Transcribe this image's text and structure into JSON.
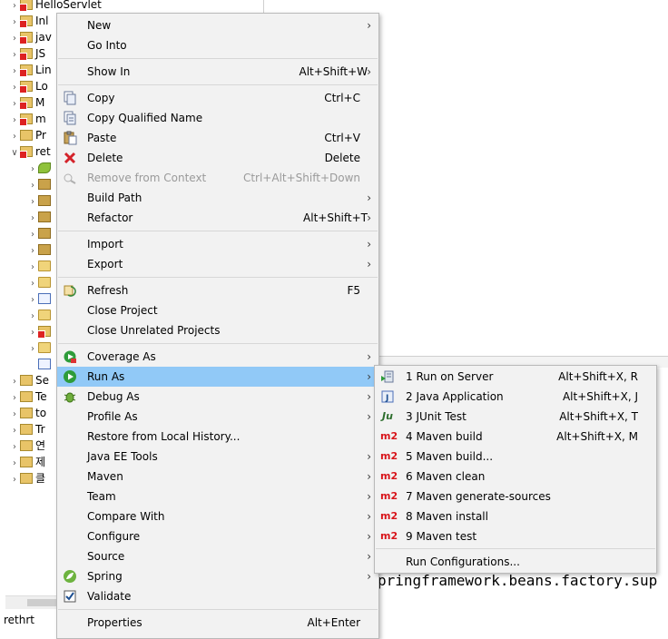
{
  "explorer": {
    "rows": [
      {
        "text": "HelloServlet",
        "icon": "project-error-icon"
      },
      {
        "text": "Inl",
        "icon": "project-error-icon"
      },
      {
        "text": "jav",
        "icon": "project-error-icon"
      },
      {
        "text": "JS",
        "icon": "project-error-icon"
      },
      {
        "text": "Lin",
        "icon": "project-error-icon"
      },
      {
        "text": "Lo",
        "icon": "project-error-icon"
      },
      {
        "text": "M",
        "icon": "project-error-icon"
      },
      {
        "text": "m",
        "icon": "project-error-icon"
      },
      {
        "text": "Pr",
        "icon": "project-icon"
      },
      {
        "text": "ret",
        "icon": "maven-project-error-icon"
      },
      {
        "text": "Se",
        "icon": "project-icon"
      },
      {
        "text": "Te",
        "icon": "project-icon"
      },
      {
        "text": "to",
        "icon": "project-icon"
      },
      {
        "text": "Tr",
        "icon": "project-icon"
      },
      {
        "text": "연",
        "icon": "project-icon"
      },
      {
        "text": "제",
        "icon": "project-icon"
      },
      {
        "text": "클",
        "icon": "project-icon"
      }
    ],
    "status_text": "rethrt"
  },
  "editor": {
    "fragments": [
      "pringframework.beans.factory.sup"
    ]
  },
  "context_menu": {
    "items": [
      {
        "label": "New",
        "submenu": true
      },
      {
        "label": "Go Into"
      },
      {
        "sep": true
      },
      {
        "label": "Show In",
        "accel": "Alt+Shift+W",
        "submenu": true
      },
      {
        "sep": true
      },
      {
        "label": "Copy",
        "accel": "Ctrl+C",
        "icon": "copy-icon"
      },
      {
        "label": "Copy Qualified Name",
        "icon": "copy-qualified-icon"
      },
      {
        "label": "Paste",
        "accel": "Ctrl+V",
        "icon": "paste-icon"
      },
      {
        "label": "Delete",
        "accel": "Delete",
        "icon": "delete-icon"
      },
      {
        "label": "Remove from Context",
        "accel": "Ctrl+Alt+Shift+Down",
        "icon": "remove-context-icon",
        "disabled": true
      },
      {
        "label": "Build Path",
        "submenu": true
      },
      {
        "label": "Refactor",
        "accel": "Alt+Shift+T",
        "submenu": true
      },
      {
        "sep": true
      },
      {
        "label": "Import",
        "submenu": true
      },
      {
        "label": "Export",
        "submenu": true
      },
      {
        "sep": true
      },
      {
        "label": "Refresh",
        "accel": "F5",
        "icon": "refresh-icon"
      },
      {
        "label": "Close Project"
      },
      {
        "label": "Close Unrelated Projects"
      },
      {
        "sep": true
      },
      {
        "label": "Coverage As",
        "submenu": true,
        "icon": "coverage-icon"
      },
      {
        "label": "Run As",
        "submenu": true,
        "icon": "run-icon",
        "highlighted": true
      },
      {
        "label": "Debug As",
        "submenu": true,
        "icon": "debug-icon"
      },
      {
        "label": "Profile As",
        "submenu": true
      },
      {
        "label": "Restore from Local History..."
      },
      {
        "label": "Java EE Tools",
        "submenu": true
      },
      {
        "label": "Maven",
        "submenu": true
      },
      {
        "label": "Team",
        "submenu": true
      },
      {
        "label": "Compare With",
        "submenu": true
      },
      {
        "label": "Configure",
        "submenu": true
      },
      {
        "label": "Source",
        "submenu": true
      },
      {
        "label": "Spring",
        "submenu": true,
        "icon": "spring-icon"
      },
      {
        "label": "Validate",
        "icon": "validate-check-icon"
      },
      {
        "sep": true
      },
      {
        "label": "Properties",
        "accel": "Alt+Enter"
      }
    ]
  },
  "run_as_submenu": {
    "items": [
      {
        "label": "1 Run on Server",
        "accel": "Alt+Shift+X, R",
        "icon": "server-run-icon",
        "glyph": ""
      },
      {
        "label": "2 Java Application",
        "accel": "Alt+Shift+X, J",
        "icon": "java-app-icon",
        "glyph": "J"
      },
      {
        "label": "3 JUnit Test",
        "accel": "Alt+Shift+X, T",
        "icon": "junit-icon",
        "glyph": "Ju"
      },
      {
        "label": "4 Maven build",
        "accel": "Alt+Shift+X, M",
        "icon": "maven-m2-icon",
        "glyph": "m2"
      },
      {
        "label": "5 Maven build...",
        "icon": "maven-m2-icon",
        "glyph": "m2"
      },
      {
        "label": "6 Maven clean",
        "icon": "maven-m2-icon",
        "glyph": "m2"
      },
      {
        "label": "7 Maven generate-sources",
        "icon": "maven-m2-icon",
        "glyph": "m2"
      },
      {
        "label": "8 Maven install",
        "icon": "maven-m2-icon",
        "glyph": "m2"
      },
      {
        "label": "9 Maven test",
        "icon": "maven-m2-icon",
        "glyph": "m2"
      },
      {
        "sep": true
      },
      {
        "label": "Run Configurations..."
      }
    ]
  },
  "colors": {
    "highlight": "#91c9f7",
    "menu_bg": "#f2f2f2",
    "maven_red": "#d8151b"
  }
}
